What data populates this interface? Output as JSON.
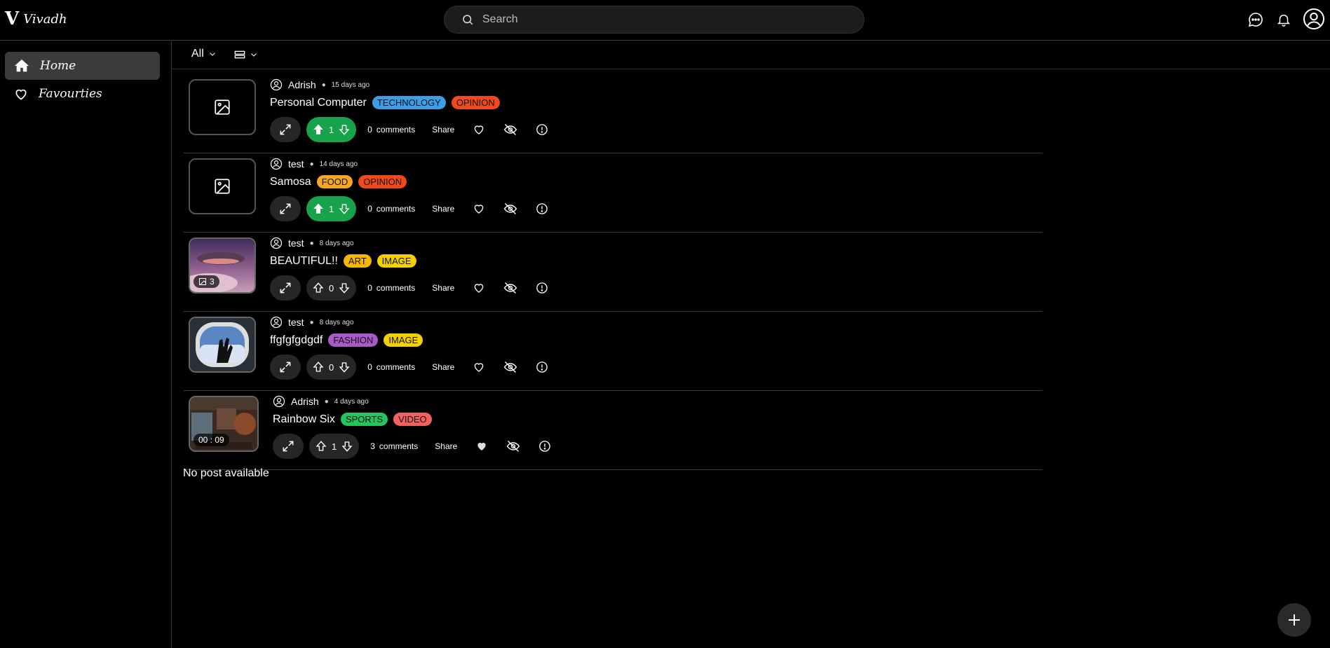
{
  "app": {
    "logo_mark": "V",
    "name": "Vivadh"
  },
  "search": {
    "placeholder": "Search"
  },
  "header_icons": [
    "chat-icon",
    "bell-icon",
    "user-icon"
  ],
  "sidebar": {
    "items": [
      {
        "label": "Home",
        "icon": "home-icon",
        "active": true
      },
      {
        "label": "Favourties",
        "icon": "heart-icon",
        "active": false
      }
    ]
  },
  "toolbar": {
    "filter_label": "All",
    "view_icon": "list-view-icon"
  },
  "posts": [
    {
      "author": "Adrish",
      "time": "15 days ago",
      "title": "Personal Computer",
      "tags": [
        {
          "label": "TECHNOLOGY",
          "color": "#3b9ee8"
        },
        {
          "label": "OPINION",
          "color": "#f04a1a"
        }
      ],
      "votes": "1",
      "voted_up": true,
      "comments_count": "0",
      "comments_label": "comments",
      "share_label": "Share",
      "liked": false,
      "thumb": "placeholder"
    },
    {
      "author": "test",
      "time": "14 days ago",
      "title": "Samosa",
      "tags": [
        {
          "label": "FOOD",
          "color": "#f5a623"
        },
        {
          "label": "OPINION",
          "color": "#f04a1a"
        }
      ],
      "votes": "1",
      "voted_up": true,
      "comments_count": "0",
      "comments_label": "comments",
      "share_label": "Share",
      "liked": false,
      "thumb": "placeholder"
    },
    {
      "author": "test",
      "time": "8 days ago",
      "title": "BEAUTIFUL!!",
      "tags": [
        {
          "label": "ART",
          "color": "#f5b700"
        },
        {
          "label": "IMAGE",
          "color": "#f5d000"
        }
      ],
      "votes": "0",
      "voted_up": false,
      "comments_count": "0",
      "comments_label": "comments",
      "share_label": "Share",
      "liked": false,
      "thumb": "whale",
      "thumb_badge": "3"
    },
    {
      "author": "test",
      "time": "8 days ago",
      "title": "ffgfgfgdgdf",
      "tags": [
        {
          "label": "FASHION",
          "color": "#a85bc8"
        },
        {
          "label": "IMAGE",
          "color": "#f5d000"
        }
      ],
      "votes": "0",
      "voted_up": false,
      "comments_count": "0",
      "comments_label": "comments",
      "share_label": "Share",
      "liked": false,
      "thumb": "window"
    },
    {
      "author": "Adrish",
      "time": "4 days ago",
      "title": "Rainbow Six",
      "tags": [
        {
          "label": "SPORTS",
          "color": "#22c55e"
        },
        {
          "label": "VIDEO",
          "color": "#f26060"
        }
      ],
      "votes": "1",
      "voted_up": false,
      "comments_count": "3",
      "comments_label": "comments",
      "share_label": "Share",
      "liked": true,
      "thumb": "game",
      "thumb_badge": "00 : 09"
    }
  ],
  "empty_message": "No post available",
  "fab": {
    "icon": "plus-icon"
  }
}
